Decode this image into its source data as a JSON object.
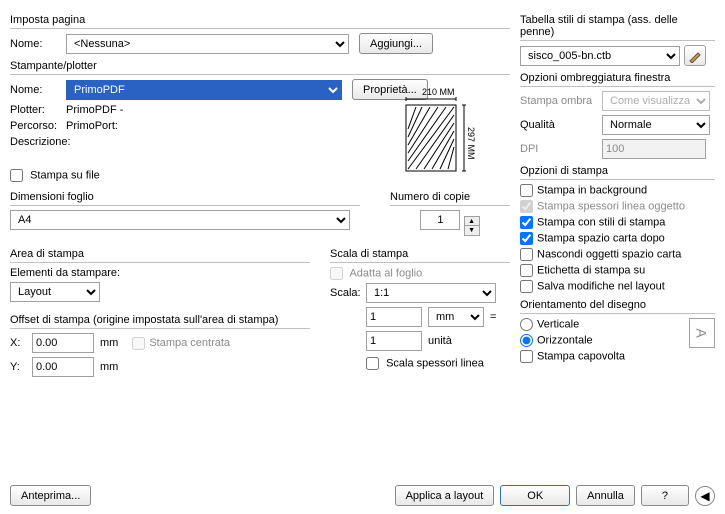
{
  "top": {
    "titleLeft": "Imposta pagina",
    "nome": "Nome:",
    "nome_val": "<Nessuna>",
    "aggiungi": "Aggiungi..."
  },
  "stampante": {
    "title": "Stampante/plotter",
    "nome": "Nome:",
    "nome_val": "PrimoPDF",
    "proprieta": "Proprietà...",
    "plotter": "Plotter:",
    "plotter_val": "PrimoPDF -",
    "percorso": "Percorso:",
    "percorso_val": "PrimoPort:",
    "descrizione": "Descrizione:",
    "stampa_su_file": "Stampa su file",
    "size_w": "210 MM",
    "size_h": "297 MM"
  },
  "foglio": {
    "title": "Dimensioni foglio",
    "val": "A4",
    "copie_lbl": "Numero di copie",
    "copie": "1"
  },
  "area": {
    "title": "Area di stampa",
    "elem_lbl": "Elementi da stampare:",
    "elem_val": "Layout"
  },
  "scala": {
    "title": "Scala di stampa",
    "adatta": "Adatta al foglio",
    "scala_lbl": "Scala:",
    "scala_val": "1:1",
    "v1": "1",
    "unit": "mm",
    "eq": "=",
    "v2": "1",
    "unit2": "unità",
    "spessori": "Scala spessori linea"
  },
  "offset": {
    "title": "Offset di stampa (origine impostata sull'area di stampa)",
    "x": "X:",
    "xv": "0.00",
    "xu": "mm",
    "y": "Y:",
    "yv": "0.00",
    "yu": "mm",
    "centrata": "Stampa centrata"
  },
  "tabella": {
    "title": "Tabella stili di stampa (ass. delle penne)",
    "val": "sisco_005-bn.ctb"
  },
  "ombr": {
    "title": "Opzioni ombreggiatura finestra",
    "stampa_ombra": "Stampa ombra",
    "stampa_ombra_val": "Come visualizzata",
    "qualita": "Qualità",
    "qualita_val": "Normale",
    "dpi": "DPI",
    "dpi_val": "100"
  },
  "opzioni": {
    "title": "Opzioni di stampa",
    "o1": "Stampa in background",
    "o2": "Stampa spessori linea oggetto",
    "o3": "Stampa con stili di stampa",
    "o4": "Stampa spazio carta dopo",
    "o5": "Nascondi oggetti spazio carta",
    "o6": "Etichetta di stampa su",
    "o7": "Salva modifiche nel layout"
  },
  "orient": {
    "title": "Orientamento del disegno",
    "v": "Verticale",
    "h": "Orizzontale",
    "cap": "Stampa capovolta",
    "icon": "A"
  },
  "btns": {
    "anteprima": "Anteprima...",
    "applica": "Applica a layout",
    "ok": "OK",
    "annulla": "Annulla",
    "help": "?",
    "collapse": "◀"
  }
}
